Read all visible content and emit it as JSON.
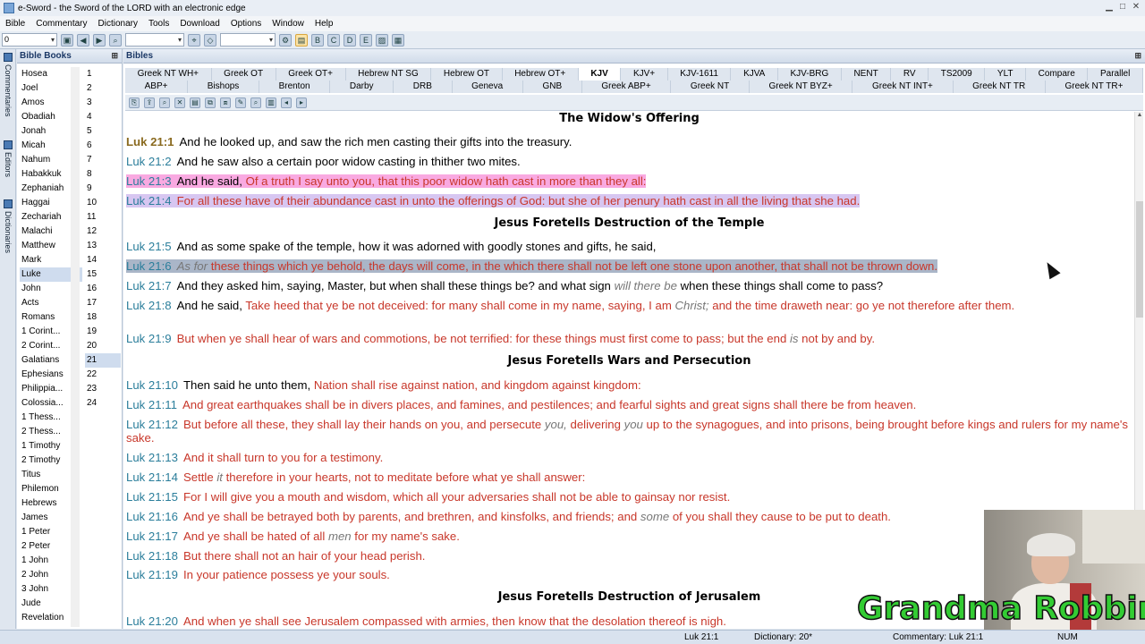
{
  "window": {
    "title": "e-Sword - the Sword of the LORD with an electronic edge"
  },
  "menu": [
    "Bible",
    "Commentary",
    "Dictionary",
    "Tools",
    "Download",
    "Options",
    "Window",
    "Help"
  ],
  "toolbar": {
    "verse_combo_value": "0"
  },
  "side_tabs": [
    "Commentaries",
    "Editors",
    "Dictionaries"
  ],
  "book_panel": {
    "title": "Bible Books",
    "books": [
      "Hosea",
      "Joel",
      "Amos",
      "Obadiah",
      "Jonah",
      "Micah",
      "Nahum",
      "Habakkuk",
      "Zephaniah",
      "Haggai",
      "Zechariah",
      "Malachi",
      "Matthew",
      "Mark",
      "Luke",
      "John",
      "Acts",
      "Romans",
      "1 Corint...",
      "2 Corint...",
      "Galatians",
      "Ephesians",
      "Philippia...",
      "Colossia...",
      "1 Thess...",
      "2 Thess...",
      "1 Timothy",
      "2 Timothy",
      "Titus",
      "Philemon",
      "Hebrews",
      "James",
      "1 Peter",
      "2 Peter",
      "1 John",
      "2 John",
      "3 John",
      "Jude",
      "Revelation"
    ],
    "selected_book": "Luke",
    "chapters": [
      "1",
      "2",
      "3",
      "4",
      "5",
      "6",
      "7",
      "8",
      "9",
      "10",
      "11",
      "12",
      "13",
      "14",
      "15",
      "16",
      "17",
      "18",
      "19",
      "20",
      "21",
      "22",
      "23",
      "24"
    ],
    "selected_chapter": "21"
  },
  "bible_panel": {
    "title": "Bibles",
    "tabs_row1": [
      "Greek NT WH+",
      "Greek OT",
      "Greek OT+",
      "Hebrew NT SG",
      "Hebrew OT",
      "Hebrew OT+",
      "KJV",
      "KJV+",
      "KJV-1611",
      "KJVA",
      "KJV-BRG",
      "NENT",
      "RV",
      "TS2009",
      "YLT",
      "Compare",
      "Parallel"
    ],
    "tabs_row2": [
      "ABP+",
      "Bishops",
      "Brenton",
      "Darby",
      "DRB",
      "Geneva",
      "GNB",
      "Greek ABP+",
      "Greek NT",
      "Greek NT BYZ+",
      "Greek NT INT+",
      "Greek NT TR",
      "Greek NT TR+"
    ],
    "active_tab": "KJV",
    "headings": [
      "The Widow's Offering",
      "Jesus Foretells Destruction of the Temple",
      "Jesus Foretells Wars and Persecution",
      "Jesus Foretells Destruction of Jerusalem"
    ],
    "verses": [
      {
        "ref": "Luk 21:1",
        "a": "And he looked up, and saw the rich men casting their gifts into the treasury."
      },
      {
        "ref": "Luk 21:2",
        "a": "And he saw also a certain poor widow casting in thither two mites."
      },
      {
        "ref": "Luk 21:3",
        "a": "And he said, ",
        "b": "Of a truth I say unto you, that this poor widow hath cast in more than they all:"
      },
      {
        "ref": "Luk 21:4",
        "a": "For all these have of their abundance cast in unto the offerings of God: but she of her penury hath cast in all the living that she had."
      },
      {
        "ref": "Luk 21:5",
        "a": "And as some spake of the temple, how it was adorned with goodly stones and gifts, he said,"
      },
      {
        "ref": "Luk 21:6",
        "i": "As for",
        "a": " these things which ye behold, the days will come, in the which there shall not be left one stone upon another, that shall not be thrown down."
      },
      {
        "ref": "Luk 21:7",
        "a": "And they asked him, saying, Master, but when shall these things be? and what sign ",
        "i": "will there be",
        "c": " when these things shall come to pass?"
      },
      {
        "ref": "Luk 21:8",
        "a": "And he said, ",
        "b": "Take heed that ye be not deceived: for many shall come in my name, saying, I am ",
        "i": "Christ;",
        "c": " and the time draweth near: go ye not therefore after them."
      },
      {
        "ref": "Luk 21:9",
        "a": "But when ye shall hear of wars and commotions, be not terrified: for these things must first come to pass; but the end ",
        "i": "is",
        "c": " not by and by."
      },
      {
        "ref": "Luk 21:10",
        "a": "Then said he unto them, ",
        "b": "Nation shall rise against nation, and kingdom against kingdom:"
      },
      {
        "ref": "Luk 21:11",
        "a": "And great earthquakes shall be in divers places, and famines, and pestilences; and fearful sights and great signs shall there be from heaven."
      },
      {
        "ref": "Luk 21:12",
        "a": "But before all these, they shall lay their hands on you, and persecute ",
        "i": "you,",
        "c": " delivering ",
        "i2": "you",
        "d": " up to the synagogues, and into prisons, being brought before kings and rulers for my name's sake."
      },
      {
        "ref": "Luk 21:13",
        "a": "And it shall turn to you for a testimony."
      },
      {
        "ref": "Luk 21:14",
        "a": "Settle ",
        "i": "it",
        "c": " therefore in your hearts, not to meditate before what ye shall answer:"
      },
      {
        "ref": "Luk 21:15",
        "a": "For I will give you a mouth and wisdom, which all your adversaries shall not be able to gainsay nor resist."
      },
      {
        "ref": "Luk 21:16",
        "a": "And ye shall be betrayed both by parents, and brethren, and kinsfolks, and friends; and ",
        "i": "some",
        "c": " of you shall they cause to be put to death."
      },
      {
        "ref": "Luk 21:17",
        "a": "And ye shall be hated of all ",
        "i": "men",
        "c": " for my name's sake."
      },
      {
        "ref": "Luk 21:18",
        "a": "But there shall not an hair of your head perish."
      },
      {
        "ref": "Luk 21:19",
        "a": "In your patience possess ye your souls."
      },
      {
        "ref": "Luk 21:20",
        "a": "And when ye shall see Jerusalem compassed with armies, then know that the desolation thereof is nigh."
      }
    ]
  },
  "status": {
    "verse": "Luk 21:1",
    "dictionary": "Dictionary: 20*",
    "commentary": "Commentary: Luk 21:1",
    "num": "NUM"
  },
  "watermark": "Grandma Robbin",
  "colors": {
    "ref": "#2b7e9b",
    "words_of_christ": "#c8372a",
    "highlight_pink": "#f9a9e1",
    "highlight_violet": "#d7c6f1",
    "highlight_gray": "#aab6c8"
  }
}
